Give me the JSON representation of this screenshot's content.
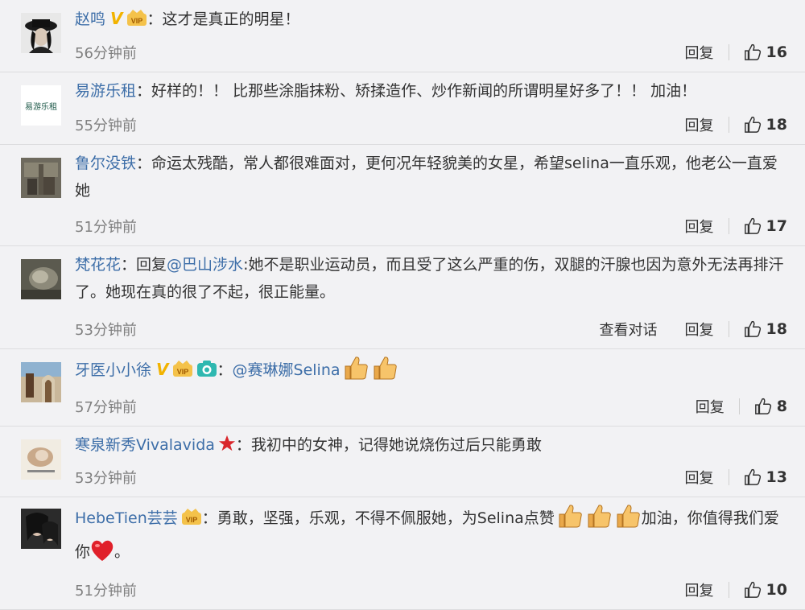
{
  "comments": [
    {
      "username": "赵鸣",
      "badges": [
        "V",
        "vip"
      ],
      "segments": [
        {
          "type": "text",
          "value": "这才是真正的明星！"
        }
      ],
      "time": "56分钟前",
      "actions": [
        "回复"
      ],
      "likes": "16"
    },
    {
      "username": "易游乐租",
      "avatar_text": "易游乐租",
      "badges": [],
      "segments": [
        {
          "type": "text",
          "value": "好样的！！ 比那些涂脂抹粉、矫揉造作、炒作新闻的所谓明星好多了！！ 加油！"
        }
      ],
      "time": "55分钟前",
      "actions": [
        "回复"
      ],
      "likes": "18"
    },
    {
      "username": "鲁尔没铁",
      "badges": [],
      "segments": [
        {
          "type": "text",
          "value": "命运太残酷，常人都很难面对，更何况年轻貌美的女星，希望selina一直乐观，他老公一直爱她"
        }
      ],
      "time": "51分钟前",
      "actions": [
        "回复"
      ],
      "likes": "17"
    },
    {
      "username": "梵花花",
      "badges": [],
      "segments": [
        {
          "type": "text",
          "value": "回复"
        },
        {
          "type": "mention",
          "value": "@巴山涉水"
        },
        {
          "type": "text",
          "value": ":她不是职业运动员，而且受了这么严重的伤，双腿的汗腺也因为意外无法再排汗了。她现在真的很了不起，很正能量。"
        }
      ],
      "time": "53分钟前",
      "actions": [
        "查看对话",
        "回复"
      ],
      "likes": "18"
    },
    {
      "username": "牙医小小徐",
      "badges": [
        "V",
        "vip",
        "camera"
      ],
      "segments": [
        {
          "type": "mention",
          "value": "@赛琳娜Selina"
        }
      ],
      "emoji_thumbs": 2,
      "time": "57分钟前",
      "actions": [
        "回复"
      ],
      "likes": "8"
    },
    {
      "username": "寒泉新秀Vivalavida",
      "badges": [
        "star"
      ],
      "segments": [
        {
          "type": "text",
          "value": "我初中的女神，记得她说烧伤过后只能勇敢"
        }
      ],
      "time": "53分钟前",
      "actions": [
        "回复"
      ],
      "likes": "13"
    },
    {
      "username": "HebeTien芸芸",
      "badges": [
        "vip"
      ],
      "segments": [
        {
          "type": "text",
          "value": "勇敢，坚强，乐观，不得不佩服她，为Selina点赞"
        },
        {
          "type": "thumbs",
          "value": "3"
        },
        {
          "type": "text",
          "value": "加油，你值得我们爱你"
        },
        {
          "type": "heart",
          "value": "heart"
        },
        {
          "type": "text",
          "value": "。"
        }
      ],
      "time": "51分钟前",
      "actions": [
        "回复"
      ],
      "likes": "10"
    }
  ],
  "icons": {
    "like": "thumbs-up-icon",
    "verified": "verified-v-icon",
    "vip": "vip-crown-icon",
    "camera": "camera-icon",
    "star": "star-icon",
    "heart": "heart-icon"
  },
  "colors": {
    "username": "#3d6ea8",
    "background": "#f2f2f4",
    "vbadge": "#f2b300",
    "star": "#d9262b",
    "heart": "#e0202a"
  }
}
